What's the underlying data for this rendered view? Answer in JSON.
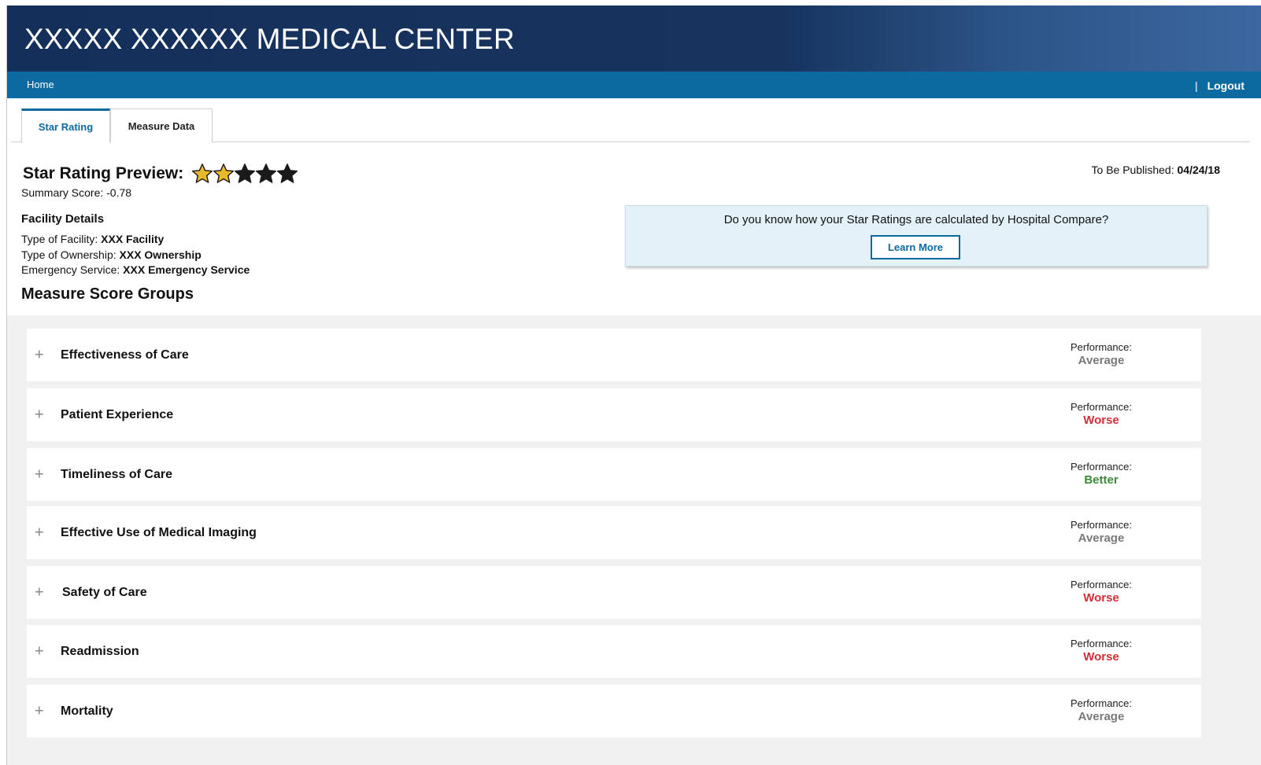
{
  "header": {
    "title": "XXXXX XXXXXX MEDICAL CENTER"
  },
  "nav": {
    "home": "Home",
    "separator": "|",
    "logout": "Logout"
  },
  "tabs": [
    {
      "label": "Star Rating",
      "active": true
    },
    {
      "label": "Measure Data",
      "active": false
    }
  ],
  "rating": {
    "heading": "Star Rating Preview:",
    "stars_filled": 2,
    "stars_total": 5,
    "summary_label": "Summary Score: ",
    "summary_value": "-0.78",
    "published_label": "To Be Published: ",
    "published_date": "04/24/18"
  },
  "facility": {
    "title": "Facility Details",
    "type_label": "Type of Facility: ",
    "type_value": "XXX Facility",
    "ownership_label": "Type of Ownership: ",
    "ownership_value": "XXX Ownership",
    "emergency_label": "Emergency Service: ",
    "emergency_value": "XXX Emergency Service"
  },
  "info": {
    "question": "Do you know how your Star Ratings are calculated by Hospital Compare?",
    "button": "Learn More"
  },
  "groups": {
    "title": "Measure Score Groups",
    "perf_label": "Performance:",
    "items": [
      {
        "label": "Effectiveness of Care",
        "performance": "Average"
      },
      {
        "label": "Patient Experience",
        "performance": "Worse"
      },
      {
        "label": "Timeliness of Care",
        "performance": "Better"
      },
      {
        "label": "Effective Use of Medical Imaging",
        "performance": "Average"
      },
      {
        "label": "Safety of Care",
        "performance": "Worse"
      },
      {
        "label": "Readmission",
        "performance": "Worse"
      },
      {
        "label": "Mortality",
        "performance": "Average"
      }
    ]
  },
  "colors": {
    "Average": "#7a7a7a",
    "Worse": "#d0303a",
    "Better": "#3a8a3a",
    "star_filled": "#e8b92a",
    "star_empty": "#1a1a1a"
  },
  "icons": {
    "expand": "plus-icon",
    "star": "star-icon"
  }
}
